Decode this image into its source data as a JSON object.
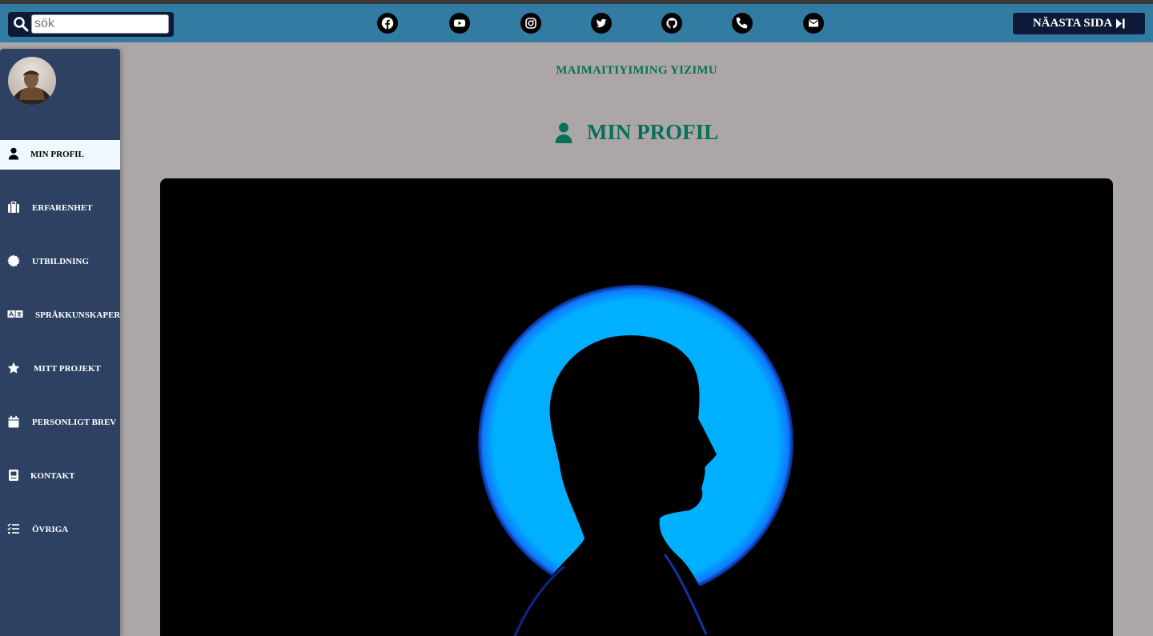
{
  "search": {
    "placeholder": "sök"
  },
  "social_icons": [
    "facebook-icon",
    "youtube-icon",
    "instagram-icon",
    "twitter-icon",
    "github-icon",
    "phone-icon",
    "envelope-icon"
  ],
  "next_button": {
    "label": "NÄASTA SIDA"
  },
  "sidebar": {
    "items": [
      {
        "label": "MIN PROFIL",
        "icon": "user-icon",
        "active": true
      },
      {
        "label": "ERFARENHET",
        "icon": "briefcase-icon"
      },
      {
        "label": "UTBILDNING",
        "icon": "certificate-icon"
      },
      {
        "label": "SPRÅKKUNSKAPER",
        "icon": "language-icon"
      },
      {
        "label": "MITT PROJEKT",
        "icon": "star-icon"
      },
      {
        "label": "PERSONLIGT BREV",
        "icon": "calendar-icon"
      },
      {
        "label": "KONTAKT",
        "icon": "address-book-icon"
      },
      {
        "label": "ÖVRIGA",
        "icon": "list-check-icon"
      }
    ]
  },
  "main": {
    "name": "MAIMAITIYIMING YIZIMU",
    "section_title": "MIN PROFIL"
  },
  "colors": {
    "topbar": "#327ba3",
    "sidebar": "#2e4163",
    "page_background": "#aca7a6",
    "accent_green": "#06705a",
    "dark_navy": "#0d1a37",
    "hero_glow": "#00b0ff"
  }
}
